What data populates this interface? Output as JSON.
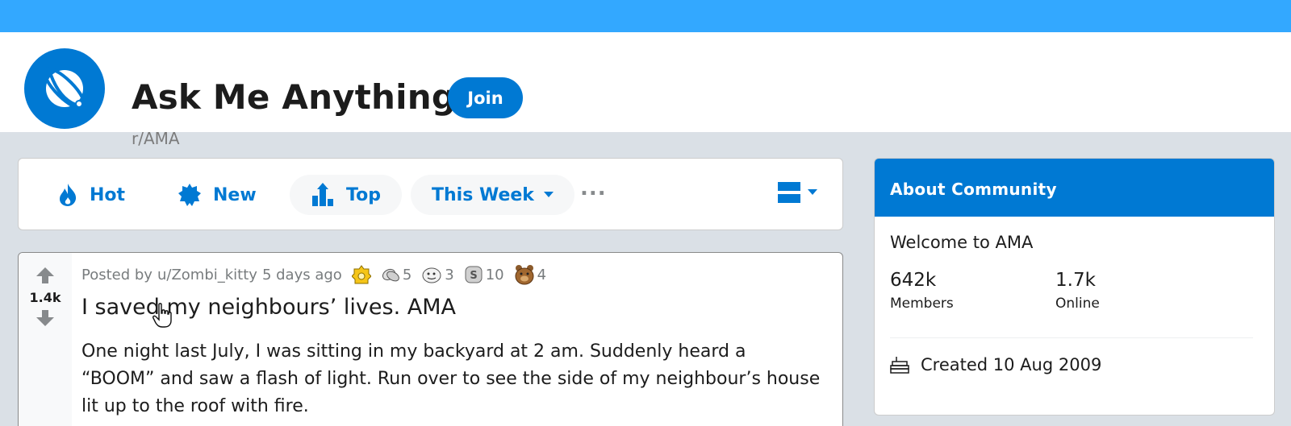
{
  "community": {
    "title": "Ask Me Anything",
    "name": "r/AMA",
    "join_label": "Join",
    "banner_color": "#33a8ff",
    "accent_color": "#0079d3"
  },
  "sortbar": {
    "hot_label": "Hot",
    "new_label": "New",
    "top_label": "Top",
    "time_label": "This Week",
    "more_label": "...",
    "active_sort": "Top"
  },
  "post": {
    "votes": "1.4k",
    "posted_prefix": "Posted by",
    "author": "u/Zombi_kitty",
    "age": "5 days ago",
    "awards": [
      {
        "icon": "gold-medal-icon",
        "count": ""
      },
      {
        "icon": "hands-icon",
        "count": "5"
      },
      {
        "icon": "face-icon",
        "count": "3"
      },
      {
        "icon": "silver-coin-icon",
        "count": "10"
      },
      {
        "icon": "bear-icon",
        "count": "4"
      }
    ],
    "title": "I saved my neighbours’ lives. AMA",
    "body": "One night last July, I was sitting in my backyard at 2 am. Suddenly heard a “BOOM” and saw a flash of light. Run over to see the side of my neighbour’s house lit up to the roof with fire."
  },
  "about": {
    "heading": "About Community",
    "welcome": "Welcome to AMA",
    "members_value": "642k",
    "members_label": "Members",
    "online_value": "1.7k",
    "online_label": "Online",
    "created": "Created 10 Aug 2009"
  }
}
